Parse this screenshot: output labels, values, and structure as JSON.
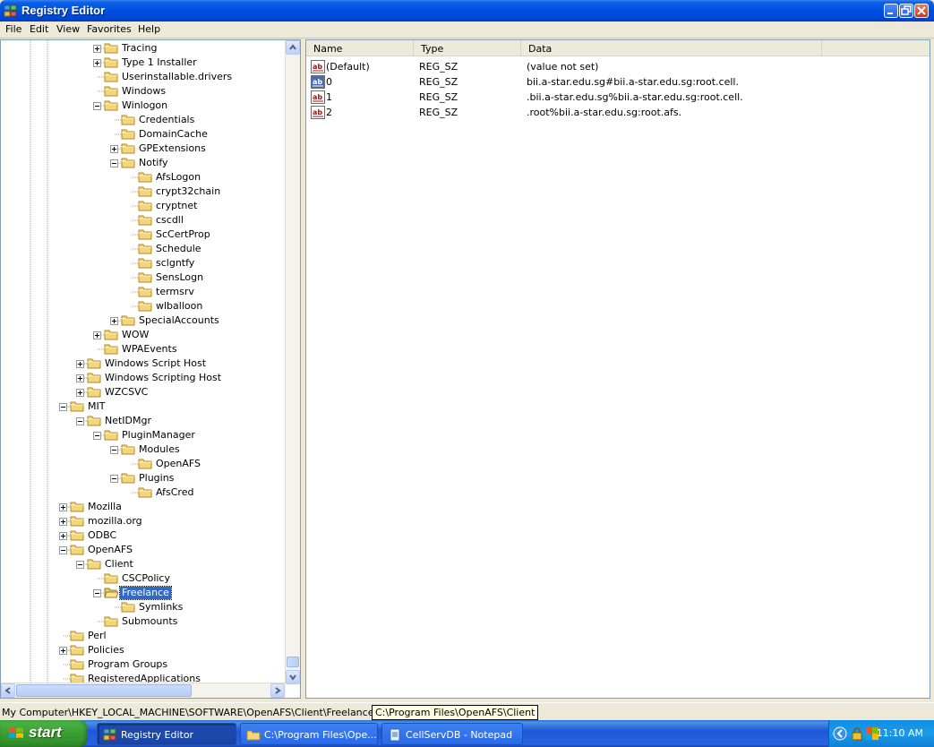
{
  "window": {
    "title": "Registry Editor"
  },
  "menu": [
    "File",
    "Edit",
    "View",
    "Favorites",
    "Help"
  ],
  "tree": [
    {
      "label": "Tracing",
      "level": 3,
      "expander": "plus"
    },
    {
      "label": "Type 1 Installer",
      "level": 3,
      "expander": "plus"
    },
    {
      "label": "Userinstallable.drivers",
      "level": 3,
      "expander": ""
    },
    {
      "label": "Windows",
      "level": 3,
      "expander": ""
    },
    {
      "label": "Winlogon",
      "level": 3,
      "expander": "minus"
    },
    {
      "label": "Credentials",
      "level": 4,
      "expander": ""
    },
    {
      "label": "DomainCache",
      "level": 4,
      "expander": ""
    },
    {
      "label": "GPExtensions",
      "level": 4,
      "expander": "plus"
    },
    {
      "label": "Notify",
      "level": 4,
      "expander": "minus"
    },
    {
      "label": "AfsLogon",
      "level": 5,
      "expander": ""
    },
    {
      "label": "crypt32chain",
      "level": 5,
      "expander": ""
    },
    {
      "label": "cryptnet",
      "level": 5,
      "expander": ""
    },
    {
      "label": "cscdll",
      "level": 5,
      "expander": ""
    },
    {
      "label": "ScCertProp",
      "level": 5,
      "expander": ""
    },
    {
      "label": "Schedule",
      "level": 5,
      "expander": ""
    },
    {
      "label": "sclgntfy",
      "level": 5,
      "expander": ""
    },
    {
      "label": "SensLogn",
      "level": 5,
      "expander": ""
    },
    {
      "label": "termsrv",
      "level": 5,
      "expander": ""
    },
    {
      "label": "wlballoon",
      "level": 5,
      "expander": ""
    },
    {
      "label": "SpecialAccounts",
      "level": 4,
      "expander": "plus"
    },
    {
      "label": "WOW",
      "level": 3,
      "expander": "plus"
    },
    {
      "label": "WPAEvents",
      "level": 3,
      "expander": ""
    },
    {
      "label": "Windows Script Host",
      "level": 2,
      "expander": "plus"
    },
    {
      "label": "Windows Scripting Host",
      "level": 2,
      "expander": "plus"
    },
    {
      "label": "WZCSVC",
      "level": 2,
      "expander": "plus"
    },
    {
      "label": "MIT",
      "level": 1,
      "expander": "minus"
    },
    {
      "label": "NetIDMgr",
      "level": 2,
      "expander": "minus"
    },
    {
      "label": "PluginManager",
      "level": 3,
      "expander": "minus"
    },
    {
      "label": "Modules",
      "level": 4,
      "expander": "minus"
    },
    {
      "label": "OpenAFS",
      "level": 5,
      "expander": ""
    },
    {
      "label": "Plugins",
      "level": 4,
      "expander": "minus"
    },
    {
      "label": "AfsCred",
      "level": 5,
      "expander": ""
    },
    {
      "label": "Mozilla",
      "level": 1,
      "expander": "plus"
    },
    {
      "label": "mozilla.org",
      "level": 1,
      "expander": "plus"
    },
    {
      "label": "ODBC",
      "level": 1,
      "expander": "plus"
    },
    {
      "label": "OpenAFS",
      "level": 1,
      "expander": "minus"
    },
    {
      "label": "Client",
      "level": 2,
      "expander": "minus"
    },
    {
      "label": "CSCPolicy",
      "level": 3,
      "expander": ""
    },
    {
      "label": "Freelance",
      "level": 3,
      "expander": "minus",
      "selected": true
    },
    {
      "label": "Symlinks",
      "level": 4,
      "expander": ""
    },
    {
      "label": "Submounts",
      "level": 3,
      "expander": ""
    },
    {
      "label": "Perl",
      "level": 1,
      "expander": ""
    },
    {
      "label": "Policies",
      "level": 1,
      "expander": "plus"
    },
    {
      "label": "Program Groups",
      "level": 1,
      "expander": ""
    },
    {
      "label": "RegisteredApplications",
      "level": 1,
      "expander": ""
    }
  ],
  "list": {
    "columns": [
      "Name",
      "Type",
      "Data"
    ],
    "rows": [
      {
        "name": "(Default)",
        "type": "REG_SZ",
        "data": "(value not set)",
        "icon": "string-value-icon"
      },
      {
        "name": "0",
        "type": "REG_SZ",
        "data": "bii.a-star.edu.sg#bii.a-star.edu.sg:root.cell.",
        "icon": "string-value-icon",
        "highlight": true
      },
      {
        "name": "1",
        "type": "REG_SZ",
        "data": ".bii.a-star.edu.sg%bii.a-star.edu.sg:root.cell.",
        "icon": "string-value-icon"
      },
      {
        "name": "2",
        "type": "REG_SZ",
        "data": ".root%bii.a-star.edu.sg:root.afs.",
        "icon": "string-value-icon"
      }
    ]
  },
  "status": {
    "path": "My Computer\\HKEY_LOCAL_MACHINE\\SOFTWARE\\OpenAFS\\Client\\Freelance",
    "tooltip": "C:\\Program Files\\OpenAFS\\Client"
  },
  "taskbar": {
    "start": "start",
    "buttons": [
      {
        "label": "Registry Editor",
        "icon": "regedit-icon",
        "active": true
      },
      {
        "label": "C:\\Program Files\\Ope...",
        "icon": "folder-icon",
        "active": false
      },
      {
        "label": "CellServDB - Notepad",
        "icon": "notepad-icon",
        "active": false
      }
    ],
    "clock": "11:10 AM"
  },
  "colors": {
    "title": "#0050e0",
    "selection": "#316ac5",
    "folder": "#f4d67a",
    "taskbar": "#2157d7",
    "start": "#3a9d32"
  }
}
